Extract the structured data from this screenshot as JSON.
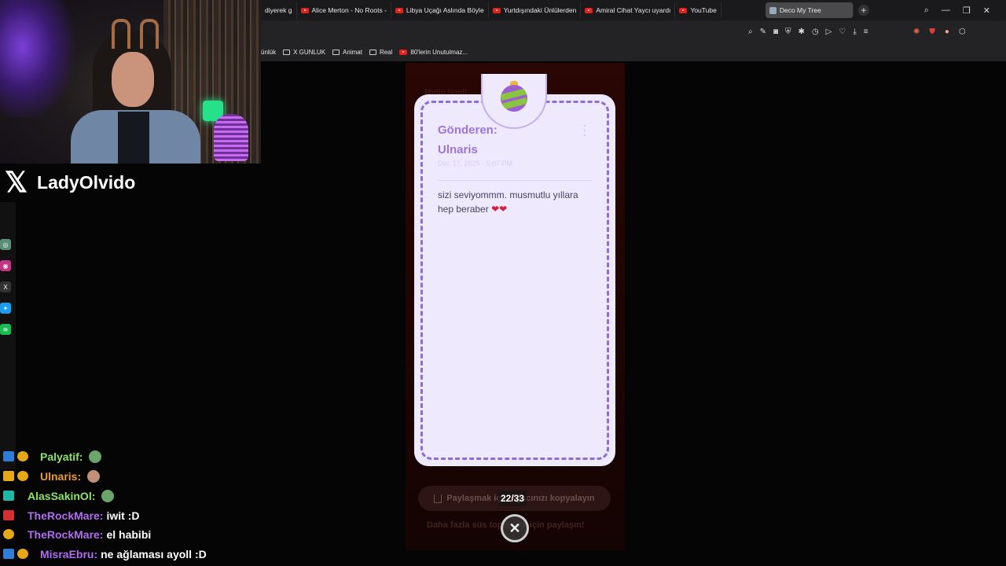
{
  "browser": {
    "tabs": [
      "diyerek g",
      "Alice Merton - No Roots -",
      "Libya Uçağı Aslında Böyle",
      "Yurtdışındaki Ünlülerden",
      "Amiral Cihat Yaycı uyardı",
      "YouTube"
    ],
    "active_tab": "Deco My Tree",
    "bookmarks": [
      "ünlük",
      "X GUNLUK",
      "Animat",
      "Real",
      "80'lerin Unutulmaz..."
    ]
  },
  "stream": {
    "x_handle": "LadyOlvido"
  },
  "card": {
    "sender_label": "Gönderen:",
    "sender_name": "Ulnaris",
    "date": "Dec 17, 2025 - 5:07 PM",
    "message": "sizi seviyommm. musmutlu yıllara hep beraber",
    "hearts": "❤❤"
  },
  "app": {
    "behind_title": "Mutlu Noel!",
    "share_label": "Paylaşmak için ağacınızı kopyalayın",
    "counter": "22/33",
    "more_text": "Daha fazla süs toplamak için paylaşın!"
  },
  "chat": [
    {
      "user": "Palyatif:",
      "color": "#8ee26a",
      "message": ""
    },
    {
      "user": "Ulnaris:",
      "color": "#ef9b35",
      "message": ""
    },
    {
      "user": "AlasSakinOl:",
      "color": "#8ee26a",
      "message": ""
    },
    {
      "user": "TheRockMare:",
      "color": "#b06cf0",
      "message": "iwit :D"
    },
    {
      "user": "TheRockMare:",
      "color": "#b06cf0",
      "message": "el habibi"
    },
    {
      "user": "MisraEbru:",
      "color": "#b06cf0",
      "message": "ne ağlaması ayoll :D"
    }
  ]
}
